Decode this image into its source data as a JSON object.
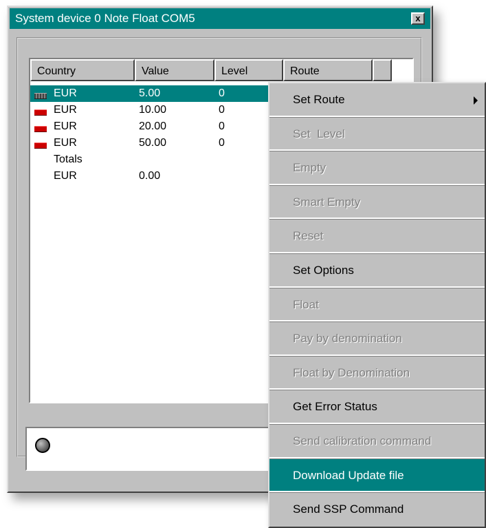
{
  "window": {
    "title": "System device 0 Note Float COM5",
    "close_label": "x"
  },
  "table": {
    "columns": [
      "Country",
      "Value",
      "Level",
      "Route"
    ],
    "rows": [
      {
        "country": "EUR",
        "value": "5.00",
        "level": "0",
        "icon": "banknote-icon",
        "selected": true
      },
      {
        "country": "EUR",
        "value": "10.00",
        "level": "0",
        "icon": "banknote-icon",
        "selected": false
      },
      {
        "country": "EUR",
        "value": "20.00",
        "level": "0",
        "icon": "banknote-icon",
        "selected": false
      },
      {
        "country": "EUR",
        "value": "50.00",
        "level": "0",
        "icon": "banknote-icon",
        "selected": false
      }
    ],
    "totals_label": "Totals",
    "totals_row": {
      "country": "EUR",
      "value": "0.00"
    }
  },
  "status": {
    "indicator_icon": "status-led-icon"
  },
  "context_menu": {
    "items": [
      {
        "label": "Set Route",
        "enabled": true,
        "submenu": true,
        "highlighted": false
      },
      {
        "label": "Set  Level",
        "enabled": false,
        "submenu": false,
        "highlighted": false
      },
      {
        "label": "Empty",
        "enabled": false,
        "submenu": false,
        "highlighted": false
      },
      {
        "label": "Smart Empty",
        "enabled": false,
        "submenu": false,
        "highlighted": false
      },
      {
        "label": "Reset",
        "enabled": false,
        "submenu": false,
        "highlighted": false
      },
      {
        "label": "Set Options",
        "enabled": true,
        "submenu": false,
        "highlighted": false
      },
      {
        "label": "Float",
        "enabled": false,
        "submenu": false,
        "highlighted": false
      },
      {
        "label": "Pay by denomination",
        "enabled": false,
        "submenu": false,
        "highlighted": false
      },
      {
        "label": "Float by Denomination",
        "enabled": false,
        "submenu": false,
        "highlighted": false
      },
      {
        "label": "Get Error Status",
        "enabled": true,
        "submenu": false,
        "highlighted": false
      },
      {
        "label": "Send calibration command",
        "enabled": false,
        "submenu": false,
        "highlighted": false
      },
      {
        "label": "Download Update file",
        "enabled": true,
        "submenu": false,
        "highlighted": true
      },
      {
        "label": "Send SSP Command",
        "enabled": true,
        "submenu": false,
        "highlighted": false
      }
    ]
  },
  "colors": {
    "accent": "#008080",
    "face": "#c0c0c0",
    "disabled_text": "#808080"
  }
}
